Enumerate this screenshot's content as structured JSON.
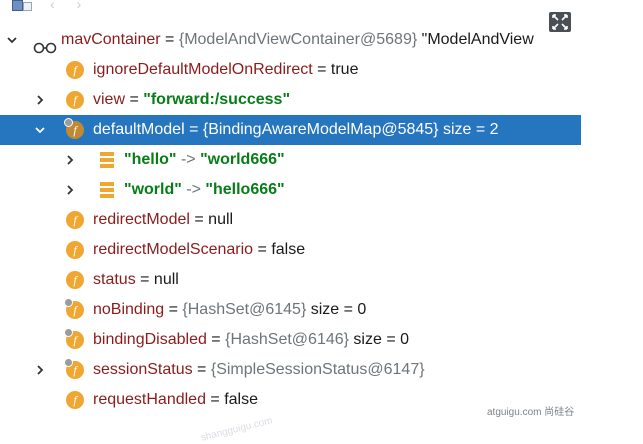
{
  "toolbar": {
    "icons": [
      "debugger-frame-icon",
      "back-icon",
      "forward-icon"
    ],
    "fullscreen_icon": "fullscreen-icon"
  },
  "tree": [
    {
      "name": "mavContainer",
      "op": " = ",
      "ref": "{ModelAndViewContainer@5689}",
      "tail": " \"ModelAndView",
      "expanded": true
    },
    {
      "name": "ignoreDefaultModelOnRedirect",
      "op": " = ",
      "value": "true"
    },
    {
      "name": "view",
      "op": " = ",
      "str": "\"forward:/success\"",
      "expandable": true
    },
    {
      "name": "defaultModel",
      "op": " = ",
      "ref": "{BindingAwareModelMap@5845}",
      "extra": "  size = 2",
      "selected": true,
      "expanded": true
    },
    {
      "key": "\"hello\"",
      "arrow": " -> ",
      "value": "\"world666\""
    },
    {
      "key": "\"world\"",
      "arrow": " -> ",
      "value": "\"hello666\""
    },
    {
      "name": "redirectModel",
      "op": " = ",
      "value": "null"
    },
    {
      "name": "redirectModelScenario",
      "op": " = ",
      "value": "false"
    },
    {
      "name": "status",
      "op": " = ",
      "value": "null"
    },
    {
      "name": "noBinding",
      "op": " = ",
      "ref": "{HashSet@6145}",
      "extra": "  size = 0"
    },
    {
      "name": "bindingDisabled",
      "op": " = ",
      "ref": "{HashSet@6146}",
      "extra": "  size = 0"
    },
    {
      "name": "sessionStatus",
      "op": " = ",
      "ref": "{SimpleSessionStatus@6147}",
      "expandable": true
    },
    {
      "name": "requestHandled",
      "op": " = ",
      "value": "false"
    }
  ],
  "field_icon_letter": "f",
  "watermark": "atguigu.com 尚硅谷",
  "watermark_faint": "shangguigu.com"
}
